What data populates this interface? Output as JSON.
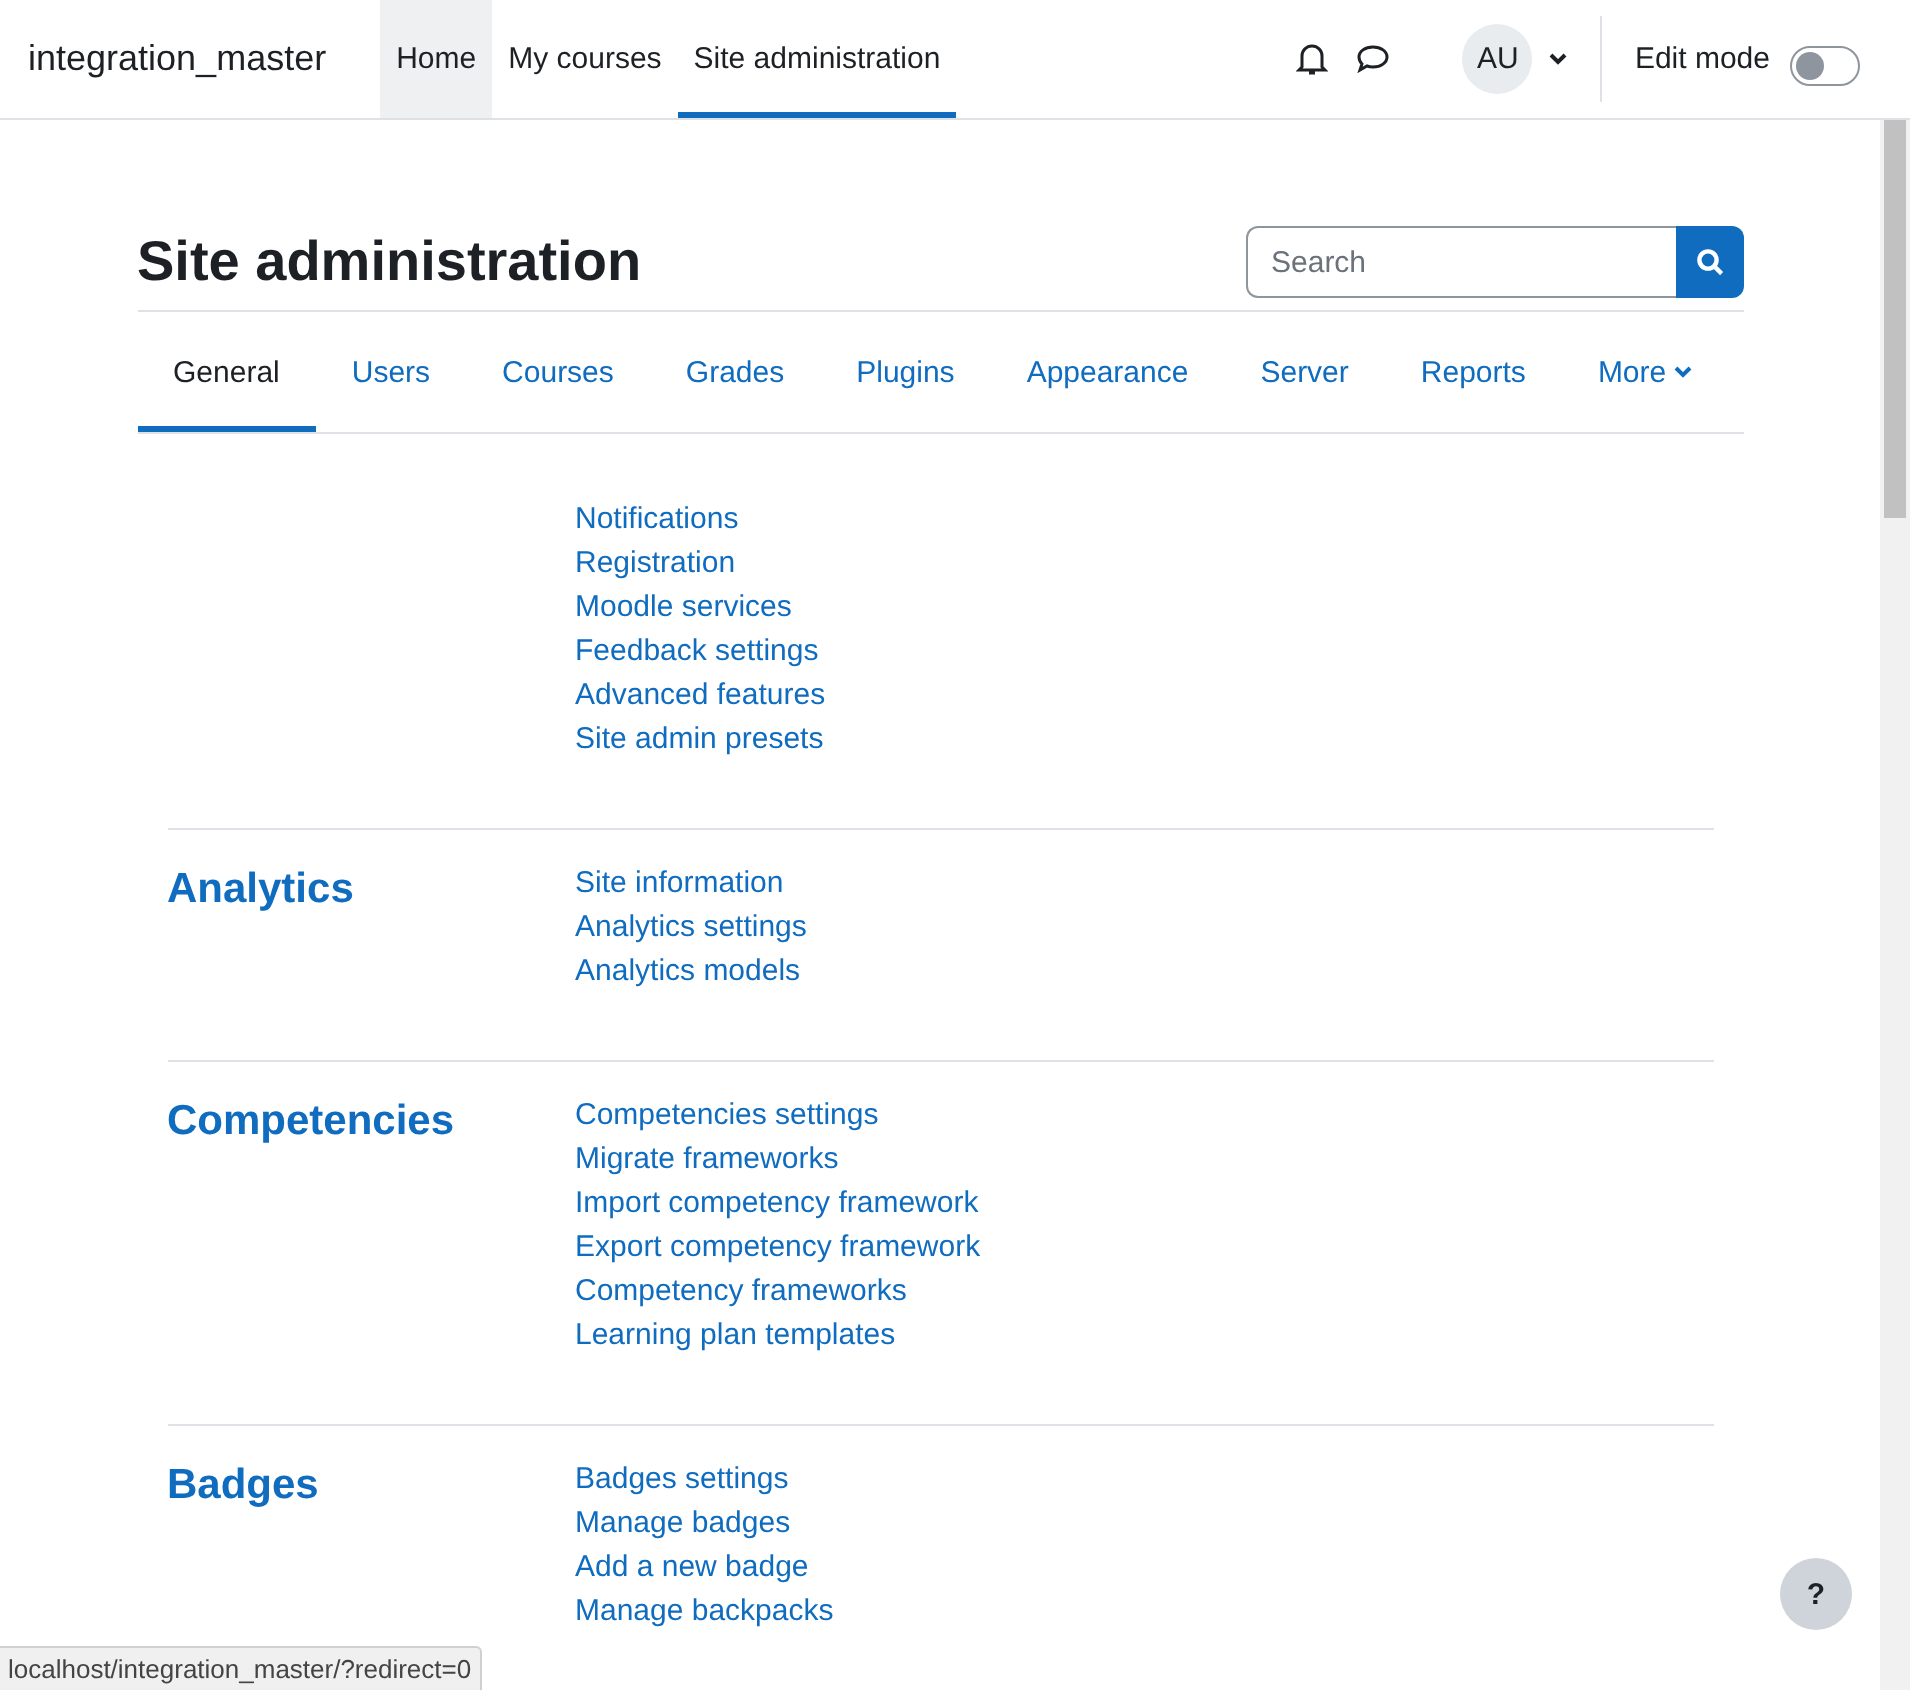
{
  "navbar": {
    "brand": "integration_master",
    "items": [
      {
        "label": "Home",
        "selected": false,
        "hovered": true
      },
      {
        "label": "My courses",
        "selected": false,
        "hovered": false
      },
      {
        "label": "Site administration",
        "selected": true,
        "hovered": false
      }
    ],
    "avatar": "AU",
    "edit_mode": {
      "label": "Edit mode",
      "on": false
    }
  },
  "page": {
    "title": "Site administration",
    "search": {
      "placeholder": "Search"
    },
    "tabs": [
      {
        "label": "General",
        "selected": true
      },
      {
        "label": "Users",
        "selected": false
      },
      {
        "label": "Courses",
        "selected": false
      },
      {
        "label": "Grades",
        "selected": false
      },
      {
        "label": "Plugins",
        "selected": false
      },
      {
        "label": "Appearance",
        "selected": false
      },
      {
        "label": "Server",
        "selected": false
      },
      {
        "label": "Reports",
        "selected": false
      },
      {
        "label": "More",
        "selected": false,
        "kind": "dropdown"
      }
    ],
    "sections": [
      {
        "links": [
          "Notifications",
          "Registration",
          "Moodle services",
          "Feedback settings",
          "Advanced features",
          "Site admin presets"
        ]
      },
      {
        "heading": "Analytics",
        "links": [
          "Site information",
          "Analytics settings",
          "Analytics models"
        ]
      },
      {
        "heading": "Competencies",
        "links": [
          "Competencies settings",
          "Migrate frameworks",
          "Import competency framework",
          "Export competency framework",
          "Competency frameworks",
          "Learning plan templates"
        ]
      },
      {
        "heading": "Badges",
        "links": [
          "Badges settings",
          "Manage badges",
          "Add a new badge",
          "Manage backpacks"
        ]
      }
    ]
  },
  "help_button": "?",
  "status_url": "localhost/integration_master/?redirect=0"
}
